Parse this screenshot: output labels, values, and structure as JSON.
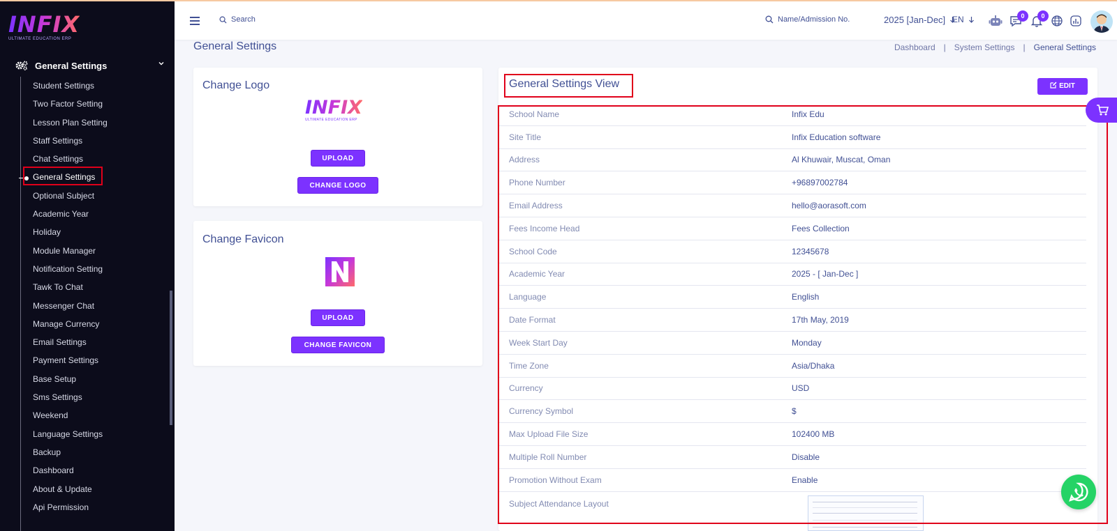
{
  "brand": {
    "name": "INFIX",
    "tagline": "ULTIMATE EDUCATION ERP"
  },
  "sidebar": {
    "section": "General Settings",
    "items": [
      "Student Settings",
      "Two Factor Setting",
      "Lesson Plan Setting",
      "Staff Settings",
      "Chat Settings",
      "General Settings",
      "Optional Subject",
      "Academic Year",
      "Holiday",
      "Module Manager",
      "Notification Setting",
      "Tawk To Chat",
      "Messenger Chat",
      "Manage Currency",
      "Email Settings",
      "Payment Settings",
      "Base Setup",
      "Sms Settings",
      "Weekend",
      "Language Settings",
      "Backup",
      "Dashboard",
      "About & Update",
      "Api Permission"
    ]
  },
  "topbar": {
    "search_label": "Search",
    "student_search_label": "Name/Admission No.",
    "year": "2025 [Jan-Dec]",
    "language": "EN",
    "chat_count": "0",
    "notification_count": "0"
  },
  "page": {
    "title": "General Settings",
    "breadcrumb": [
      "Dashboard",
      "System Settings",
      "General Settings"
    ]
  },
  "logo_card": {
    "title": "Change Logo",
    "upload": "UPLOAD",
    "change": "CHANGE LOGO"
  },
  "favicon_card": {
    "title": "Change Favicon",
    "upload": "UPLOAD",
    "change": "CHANGE FAVICON"
  },
  "view": {
    "title": "General Settings View",
    "edit": "EDIT",
    "rows": [
      {
        "label": "School Name",
        "value": "Infix Edu"
      },
      {
        "label": "Site Title",
        "value": "Infix Education software"
      },
      {
        "label": "Address",
        "value": "Al Khuwair, Muscat, Oman"
      },
      {
        "label": "Phone Number",
        "value": "+96897002784"
      },
      {
        "label": "Email Address",
        "value": "hello@aorasoft.com"
      },
      {
        "label": "Fees Income Head",
        "value": "Fees Collection"
      },
      {
        "label": "School Code",
        "value": "12345678"
      },
      {
        "label": "Academic Year",
        "value": "2025 - [ Jan-Dec ]"
      },
      {
        "label": "Language",
        "value": "English"
      },
      {
        "label": "Date Format",
        "value": "17th May, 2019"
      },
      {
        "label": "Week Start Day",
        "value": "Monday"
      },
      {
        "label": "Time Zone",
        "value": "Asia/Dhaka"
      },
      {
        "label": "Currency",
        "value": "USD"
      },
      {
        "label": "Currency Symbol",
        "value": "$"
      },
      {
        "label": "Max Upload File Size",
        "value": "102400 MB"
      },
      {
        "label": "Multiple Roll Number",
        "value": "Disable"
      },
      {
        "label": "Promotion Without Exam",
        "value": "Enable"
      },
      {
        "label": "Subject Attendance Layout",
        "value": ""
      }
    ]
  },
  "colors": {
    "accent": "#7c32ff",
    "sidebar_bg": "#0c0c1b",
    "text": "#415094",
    "highlight_box": "#e0001a",
    "whatsapp": "#25d366"
  },
  "icons": [
    "gear-icon",
    "chevron-down-icon",
    "hamburger-icon",
    "search-icon",
    "robot-icon",
    "chat-icon",
    "bell-icon",
    "globe-icon",
    "chart-icon",
    "edit-icon",
    "cart-icon",
    "whatsapp-icon"
  ]
}
